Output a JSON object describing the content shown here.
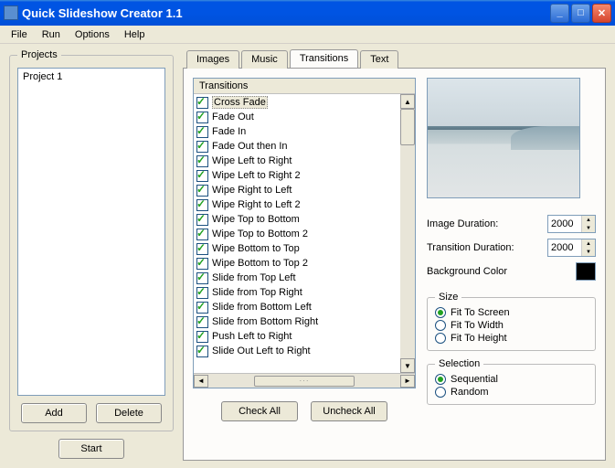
{
  "window": {
    "title": "Quick Slideshow Creator 1.1"
  },
  "menu": {
    "file": "File",
    "run": "Run",
    "options": "Options",
    "help": "Help"
  },
  "projects": {
    "legend": "Projects",
    "items": [
      "Project 1"
    ],
    "add": "Add",
    "delete": "Delete",
    "start": "Start"
  },
  "tabs": {
    "images": "Images",
    "music": "Music",
    "transitions": "Transitions",
    "text": "Text",
    "active": "transitions"
  },
  "transitions": {
    "header": "Transitions",
    "selected": 0,
    "items": [
      "Cross Fade",
      "Fade Out",
      "Fade In",
      "Fade Out then In",
      "Wipe Left to Right",
      "Wipe Left to Right 2",
      "Wipe Right to Left",
      "Wipe Right to Left 2",
      "Wipe Top to Bottom",
      "Wipe Top to Bottom 2",
      "Wipe Bottom to Top",
      "Wipe Bottom to Top 2",
      "Slide from Top Left",
      "Slide from Top Right",
      "Slide from Bottom Left",
      "Slide from Bottom Right",
      "Push Left to Right",
      "Slide Out Left to Right"
    ],
    "check_all": "Check All",
    "uncheck_all": "Uncheck All"
  },
  "settings": {
    "image_duration_label": "Image Duration:",
    "image_duration_value": "2000",
    "transition_duration_label": "Transition Duration:",
    "transition_duration_value": "2000",
    "background_color_label": "Background Color",
    "background_color_value": "#000000",
    "size": {
      "legend": "Size",
      "fit_screen": "Fit To Screen",
      "fit_width": "Fit To Width",
      "fit_height": "Fit To Height",
      "selected": "fit_screen"
    },
    "selection": {
      "legend": "Selection",
      "sequential": "Sequential",
      "random": "Random",
      "selected": "sequential"
    }
  }
}
